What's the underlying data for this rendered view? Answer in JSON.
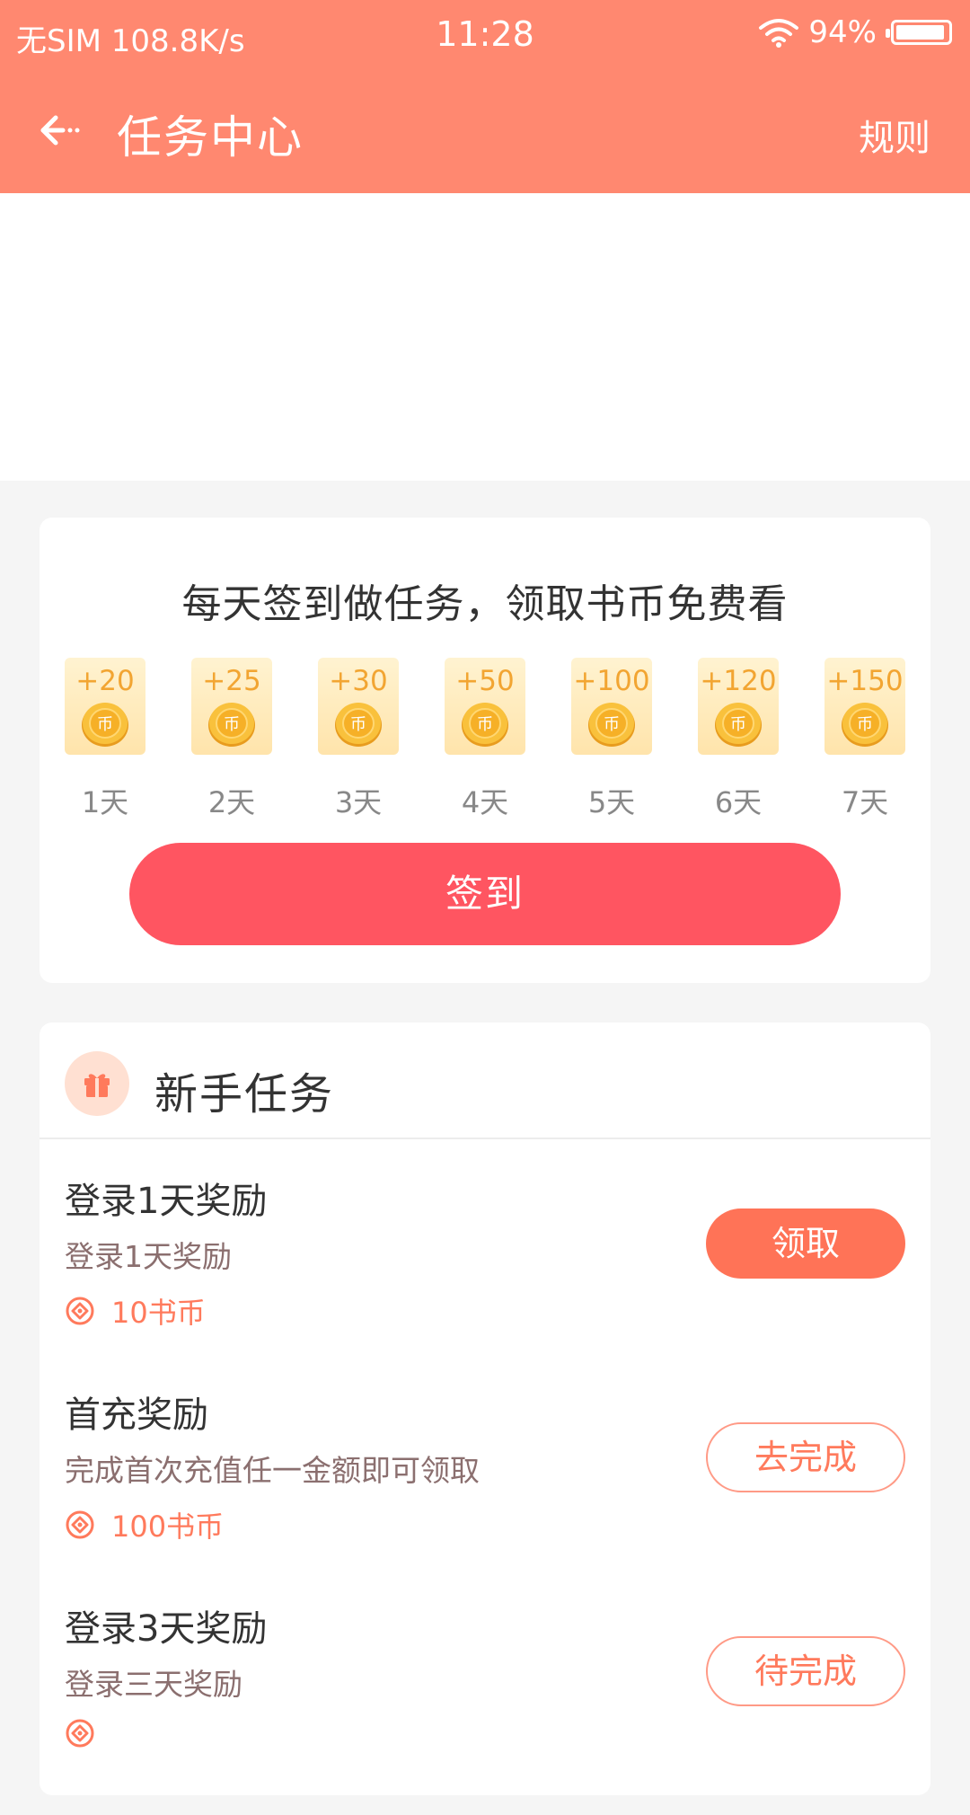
{
  "status_bar": {
    "carrier": "无SIM",
    "speed": "108.8K/s",
    "time": "11:28",
    "battery": "94%",
    "battery_level": 0.94,
    "wifi_icon": "wifi-icon"
  },
  "nav": {
    "title": "任务中心",
    "rules": "规则",
    "back_icon": "back-arrow-icon"
  },
  "signin": {
    "title": "每天签到做任务，领取书币免费看",
    "days": [
      {
        "amount": "+20",
        "label": "1天"
      },
      {
        "amount": "+25",
        "label": "2天"
      },
      {
        "amount": "+30",
        "label": "3天"
      },
      {
        "amount": "+50",
        "label": "4天"
      },
      {
        "amount": "+100",
        "label": "5天"
      },
      {
        "amount": "+120",
        "label": "6天"
      },
      {
        "amount": "+150",
        "label": "7天"
      }
    ],
    "button": "签到",
    "coin_icon": "coin-icon"
  },
  "tasks": {
    "section_title": "新手任务",
    "section_icon": "gift-icon",
    "items": [
      {
        "title": "登录1天奖励",
        "desc": "登录1天奖励",
        "reward": "10书币",
        "action": "领取",
        "action_style": "filled"
      },
      {
        "title": "首充奖励",
        "desc": "完成首次充值任一金额即可领取",
        "reward": "100书币",
        "action": "去完成",
        "action_style": "outline"
      },
      {
        "title": "登录3天奖励",
        "desc": "登录三天奖励",
        "reward": "",
        "action": "待完成",
        "action_style": "outline"
      }
    ]
  },
  "colors": {
    "header": "#ff8870",
    "primary_button": "#ff5561",
    "claim_button": "#ff7357",
    "coin_text": "#f2a532",
    "reward_text": "#ff7a5c"
  }
}
